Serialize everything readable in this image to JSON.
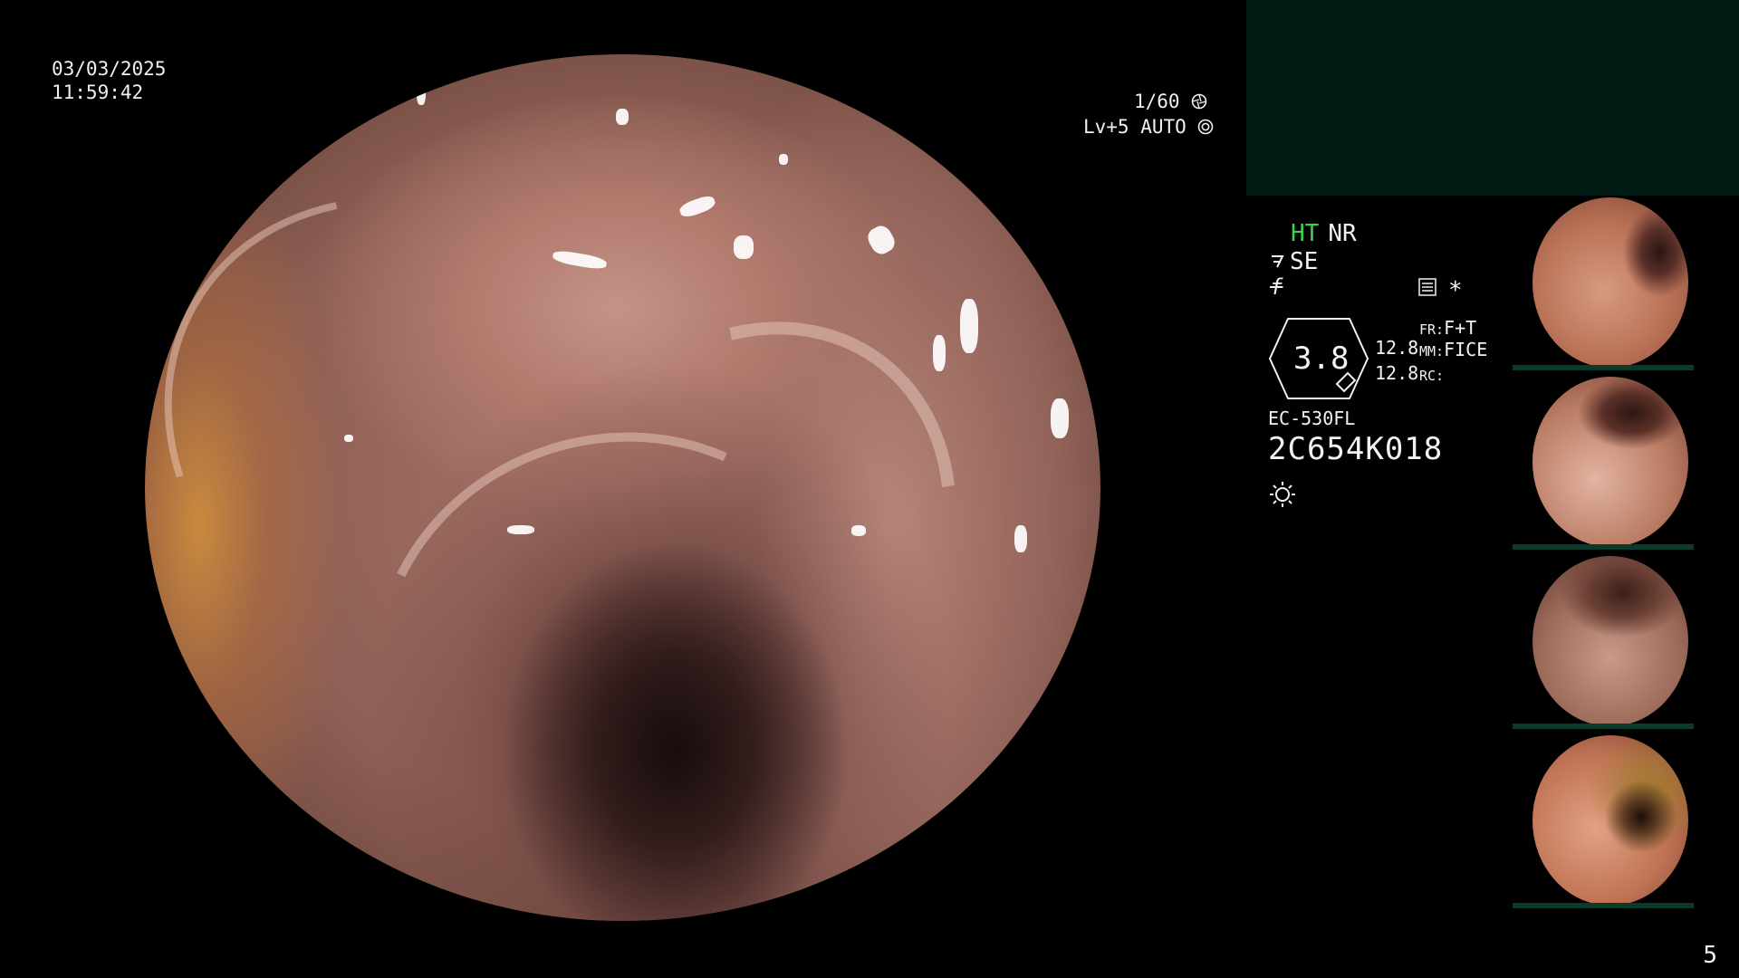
{
  "overlay": {
    "date": "03/03/2025",
    "time": "11:59:42",
    "shutter": "1/60",
    "level": "Lv+5 AUTO"
  },
  "icons": {
    "shutter_icon": "aperture-icon",
    "level_icon": "iris-icon",
    "structure_icon": "structure-enhance-icon",
    "f_icon": "f-function-icon",
    "menu_icon": "menu-list-icon",
    "light_icon": "light-source-icon"
  },
  "status": {
    "mode1": "HT",
    "mode2": "NR",
    "structure": "SE",
    "f_symbol": "f",
    "asterisk": "*",
    "mode1_color": "#36d84a"
  },
  "zoom": {
    "value": "3.8",
    "num_top": "12.8",
    "num_bottom": "12.8"
  },
  "processing": {
    "fr_label": "FR:",
    "fr_value": "F+T",
    "mm_label": "MM:",
    "mm_value": "FICE",
    "rc_label": "RC:",
    "rc_value": ""
  },
  "scope": {
    "model": "EC-530FL",
    "serial": "2C654K018"
  },
  "colors": {
    "background": "#000000",
    "info_bar": "#001c15",
    "text": "#f2f2f2",
    "thumb_bar": "#0b3a2a"
  },
  "page_number": "5"
}
